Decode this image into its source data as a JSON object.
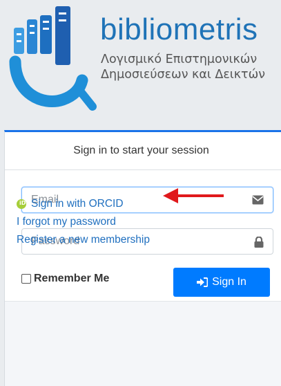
{
  "brand": {
    "name": "bibliometris",
    "tagline_line1": "Λογισμικό Επιστημονικών",
    "tagline_line2": "Δημοσιεύσεων και Δεικτών"
  },
  "login": {
    "header": "Sign in to start your session",
    "email_placeholder": "Email",
    "password_placeholder": "Password",
    "remember_label": "Remember Me",
    "signin_label": "Sign In"
  },
  "links": {
    "orcid": "Sign in with ORCID",
    "forgot": "I forgot my password",
    "register": "Register a new membership"
  },
  "colors": {
    "brand_blue": "#1f73b7",
    "primary": "#007bff",
    "orcid_green": "#a6ce39",
    "annotation_arrow": "#e0191c"
  },
  "icons": [
    "logo-icon",
    "envelope-icon",
    "lock-icon",
    "sign-in-icon",
    "orcid-icon",
    "arrow-annotation"
  ]
}
